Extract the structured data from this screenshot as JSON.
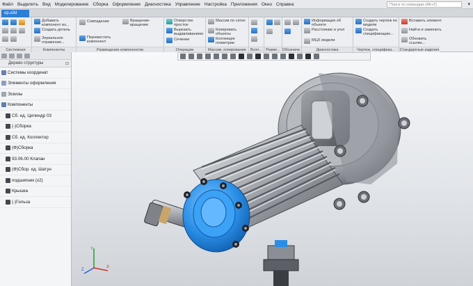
{
  "menu": {
    "items": [
      "Файл",
      "Выделить",
      "Вид",
      "Моделирование",
      "Сборка",
      "Оформление",
      "Диагностика",
      "Управление",
      "Настройка",
      "Приложения",
      "Окно",
      "Справка"
    ],
    "search_placeholder": "Поиск по командам (Alt+Z)"
  },
  "tab": {
    "doc_name": "ор.а3d"
  },
  "ribbon": {
    "groups": [
      {
        "label": "Системная",
        "commands": []
      },
      {
        "label": "Компоненты",
        "commands": [
          "Добавить компонент из...",
          "Создать деталь",
          "Зеркальное отражение..."
        ]
      },
      {
        "label": "Размещение компонентов",
        "commands": [
          "Совпадение",
          "Вращение-вращение",
          "Переместить компонент"
        ]
      },
      {
        "label": "Операции",
        "commands": [
          "Отверстие простое",
          "Вырезать выдавливанием",
          "Сечение"
        ]
      },
      {
        "label": "Массив, копирование",
        "commands": [
          "Массив по сетке",
          "Копировать объекты",
          "Коллекция геометрии"
        ]
      },
      {
        "label": "Вспо...",
        "commands": []
      },
      {
        "label": "Разме...",
        "commands": []
      },
      {
        "label": "Обозначе...",
        "commands": []
      },
      {
        "label": "Диагностика",
        "commands": [
          "Информация об объекте",
          "Расстояние и угол",
          "МЦХ модели"
        ]
      },
      {
        "label": "Чертеж, специфика...",
        "commands": [
          "Создать чертеж по модели",
          "Создать спецификацию..."
        ]
      },
      {
        "label": "Стандартные изделия",
        "commands": [
          "Вставить элемент",
          "Найти и заменить",
          "Обновить ссылки..."
        ]
      }
    ]
  },
  "tree": {
    "title": "Дерево структуры",
    "items": [
      "Системы координат",
      "Элементы оформления",
      "Эскизы",
      "Компоненты",
      "Сб. ед. Цилиндр 03",
      "(-)Сборка",
      "Сб. ед. Коллектор",
      "(Ф)Сборка",
      "93.06.00 Клапан",
      "(Ф)Сбор. ед. Шатун",
      "подшипник (x2)",
      "Крышка",
      "(-)Гильза"
    ]
  },
  "colors": {
    "accent": "#2c7fd6",
    "flange_blue": "#2a8ee6",
    "metal": "#a9adb3"
  },
  "triad": {
    "x": "X",
    "y": "Y",
    "z": "Z"
  }
}
